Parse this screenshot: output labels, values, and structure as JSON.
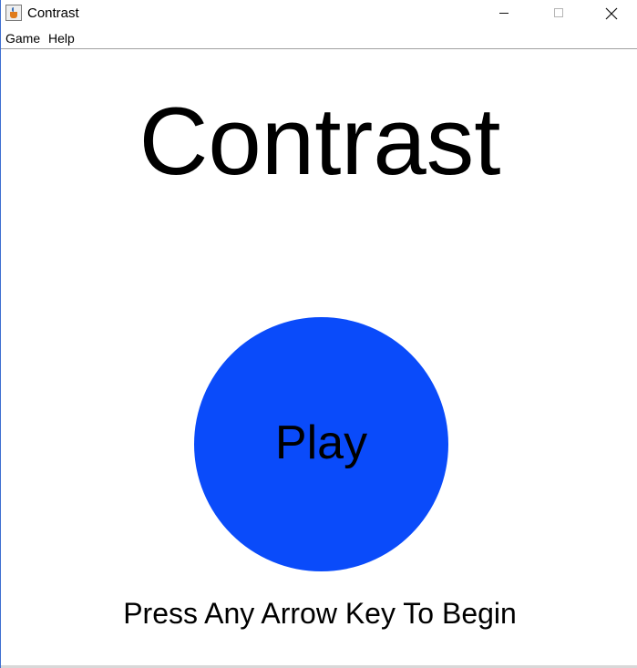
{
  "window": {
    "title": "Contrast",
    "icon": "java-cup-icon",
    "controls": [
      "minimize-icon",
      "maximize-icon",
      "close-icon"
    ]
  },
  "menubar": {
    "items": [
      {
        "label": "Game"
      },
      {
        "label": "Help"
      }
    ]
  },
  "game": {
    "title": "Contrast",
    "play_label": "Play",
    "instructions": "Press Any Arrow Key To Begin"
  },
  "colors": {
    "play_button": "#0a4bfa",
    "text": "#000000",
    "background": "#ffffff"
  }
}
